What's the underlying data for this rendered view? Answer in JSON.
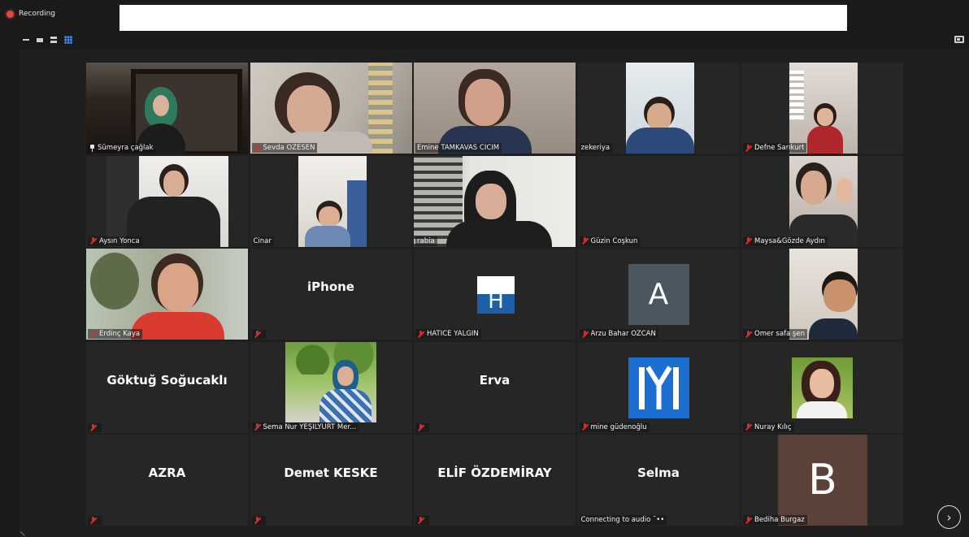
{
  "recording_label": "Recording",
  "participants": [
    {
      "name": "Sümeyra çağlak",
      "status": "pin",
      "label": "",
      "video": true
    },
    {
      "name": "Sevda ÖZESEN",
      "status": "muted",
      "label": "",
      "video": true
    },
    {
      "name": "Emine TAMKAVAS CİCİM",
      "status": "",
      "label": "",
      "video": true
    },
    {
      "name": "zekeriya",
      "status": "",
      "label": "",
      "video": true
    },
    {
      "name": "Defne Sarıkurt",
      "status": "muted",
      "label": "",
      "video": true
    },
    {
      "name": "Aysın Yonca",
      "status": "muted",
      "label": "",
      "video": true
    },
    {
      "name": "Cinar",
      "status": "",
      "label": "",
      "video": true
    },
    {
      "name": "rabia",
      "status": "",
      "label": "",
      "video": true
    },
    {
      "name": "Güzin Coşkun",
      "status": "muted",
      "label": "",
      "video": false
    },
    {
      "name": "Maysa&Gözde Aydın",
      "status": "muted",
      "label": "",
      "video": true
    },
    {
      "name": "Erdinç Kaya",
      "status": "muted",
      "label": "",
      "video": true
    },
    {
      "name": "",
      "status": "muted",
      "label": "iPhone",
      "video": false
    },
    {
      "name": "HATİCE YALGIN",
      "status": "muted",
      "label": "",
      "avatar": "H",
      "video": false
    },
    {
      "name": "Arzu Bahar ÖZCAN",
      "status": "muted",
      "label": "",
      "avatar": "A",
      "video": false
    },
    {
      "name": "Ömer safa şen",
      "status": "muted",
      "label": "",
      "video": true
    },
    {
      "name": "",
      "status": "muted",
      "label": "Göktuğ Soğucaklı",
      "video": false
    },
    {
      "name": "Sema Nur YEŞİLYURT Mer...",
      "status": "muted",
      "label": "",
      "video": true
    },
    {
      "name": "",
      "status": "muted",
      "label": "Erva",
      "video": false
    },
    {
      "name": "mine güdenoğlu",
      "status": "muted",
      "label": "",
      "avatar": "IYI",
      "video": false
    },
    {
      "name": "Nuray Kılıç",
      "status": "muted",
      "label": "",
      "video": true
    },
    {
      "name": "",
      "status": "muted",
      "label": "AZRA",
      "video": false
    },
    {
      "name": "",
      "status": "muted",
      "label": "Demet KESKE",
      "video": false
    },
    {
      "name": "",
      "status": "muted",
      "label": "ELİF ÖZDEMİRAY",
      "video": false
    },
    {
      "name": "Connecting to audio ˜••",
      "status": "",
      "label": "Selma",
      "video": false
    },
    {
      "name": "Bediha Burgaz",
      "status": "muted",
      "label": "",
      "avatar": "B",
      "video": false
    }
  ],
  "colors": {
    "active_speaker": "#a7d34d",
    "muted": "#d0312d",
    "avatar_h": "#1e5fa8",
    "avatar_a": "#4a5660",
    "avatar_iyi": "#1c6fd1",
    "avatar_b": "#5b4238"
  }
}
